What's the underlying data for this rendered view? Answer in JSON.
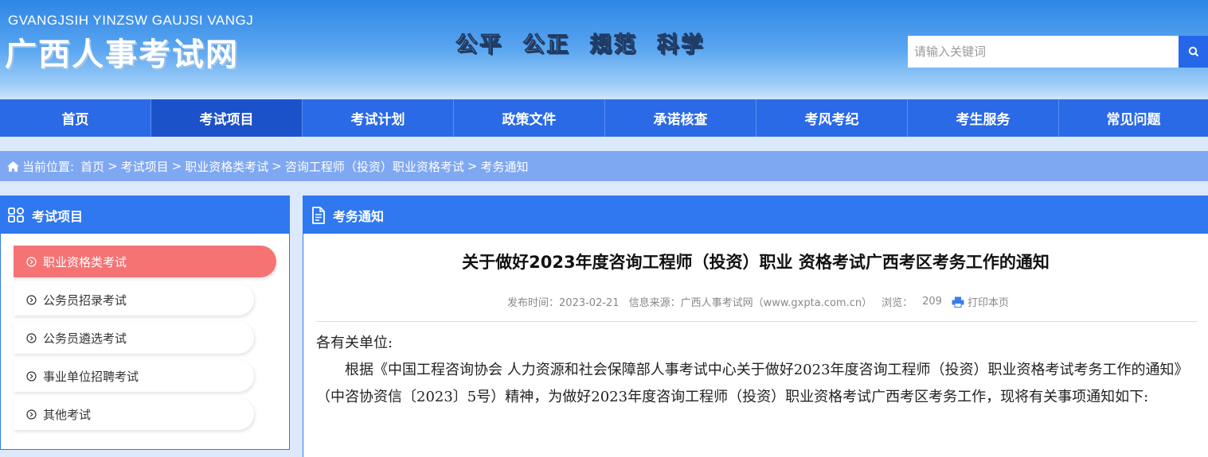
{
  "header": {
    "logo_en": "GVANGJSIH YINZSW GAUJSI VANGJ",
    "logo_cn": "广西人事考试网",
    "slogan": "公平 公正 规范 科学",
    "search_placeholder": "请输入关键词"
  },
  "nav": {
    "items": [
      "首页",
      "考试项目",
      "考试计划",
      "政策文件",
      "承诺核查",
      "考风考纪",
      "考生服务",
      "常见问题"
    ]
  },
  "breadcrumb": {
    "label": "当前位置:",
    "items": [
      "首页",
      "考试项目",
      "职业资格类考试",
      "咨询工程师（投资）职业资格考试",
      "考务通知"
    ],
    "sep": ">"
  },
  "sidebar": {
    "title": "考试项目",
    "items": [
      "职业资格类考试",
      "公务员招录考试",
      "公务员遴选考试",
      "事业单位招聘考试",
      "其他考试"
    ]
  },
  "main": {
    "panel_title": "考务通知",
    "title": "关于做好2023年度咨询工程师（投资）职业 资格考试广西考区考务工作的通知",
    "meta": {
      "date": "发布时间：2023-02-21",
      "source": "信息来源：广西人事考试网（www.gxpta.com.cn）",
      "views_label": "浏览：",
      "views": "209",
      "print": "打印本页"
    },
    "greeting": "各有关单位:",
    "paragraph": "根据《中国工程咨询协会 人力资源和社会保障部人事考试中心关于做好2023年度咨询工程师（投资）职业资格考试考务工作的通知》（中咨协资信〔2023〕5号）精神，为做好2023年度咨询工程师（投资）职业资格考试广西考区考务工作，现将有关事项通知如下:"
  },
  "colors": {
    "nav": "#2a6ae6",
    "nav_active": "#1c52c9",
    "panel_head": "#2f78f0",
    "side_active": "#f67373",
    "breadcrumb": "#7fa8f2"
  }
}
